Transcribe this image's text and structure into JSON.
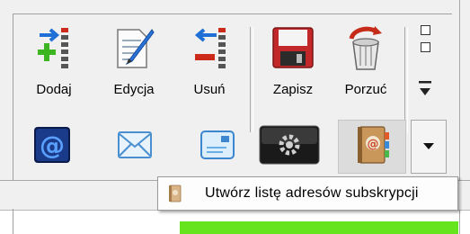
{
  "toolbar": {
    "buttons": [
      {
        "label": "Dodaj",
        "icon": "add-list-icon"
      },
      {
        "label": "Edycja",
        "icon": "edit-document-icon"
      },
      {
        "label": "Usuń",
        "icon": "remove-list-icon"
      },
      {
        "label": "Zapisz",
        "icon": "save-floppy-icon"
      },
      {
        "label": "Porzuć",
        "icon": "discard-trash-icon"
      }
    ],
    "row2": [
      {
        "icon": "at-sign-icon"
      },
      {
        "icon": "envelope-icon"
      },
      {
        "icon": "message-card-icon"
      },
      {
        "icon": "gear-settings-icon"
      },
      {
        "icon": "address-book-icon"
      }
    ]
  },
  "menu": {
    "items": [
      {
        "label": "Utwórz listę adresów subskrypcji",
        "icon": "address-book-small-icon"
      }
    ]
  },
  "colors": {
    "accent_blue": "#1f6fd6",
    "green_add": "#3cb521",
    "red_remove": "#cc2a1a",
    "save_red": "#c2282a",
    "progress_green": "#66e51e"
  }
}
